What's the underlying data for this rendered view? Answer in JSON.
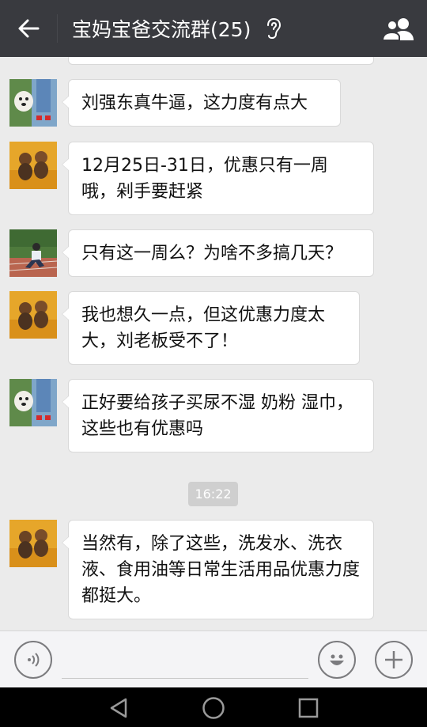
{
  "header": {
    "title": "宝妈宝爸交流群(25)",
    "back_icon": "arrow-left-icon",
    "earpiece_icon": "ear-icon",
    "members_icon": "group-members-icon"
  },
  "messages": [
    {
      "text": "刘强东真牛逼，这力度有点大",
      "avatar": "kid-with-dog"
    },
    {
      "text": "12月25日-31日，优惠只有一周哦，剁手要赶紧",
      "avatar": "golden-dogs"
    },
    {
      "text": "只有这一周么？为啥不多搞几天？",
      "avatar": "person-on-track"
    },
    {
      "text": "我也想久一点，但这优惠力度太大，刘老板受不了！",
      "avatar": "golden-dogs"
    },
    {
      "text": "正好要给孩子买尿不湿 奶粉 湿巾，这些也有优惠吗",
      "avatar": "kid-with-dog"
    },
    {
      "text": "当然有，除了这些，洗发水、洗衣液、食用油等日常生活用品优惠力度都挺大。",
      "avatar": "golden-dogs"
    }
  ],
  "timestamp": "16:22",
  "input_bar": {
    "voice_icon": "voice-icon",
    "emoji_icon": "emoji-icon",
    "add_icon": "plus-icon"
  },
  "system_nav": {
    "back_icon": "triangle-back-icon",
    "home_icon": "circle-home-icon",
    "recents_icon": "square-recents-icon"
  }
}
